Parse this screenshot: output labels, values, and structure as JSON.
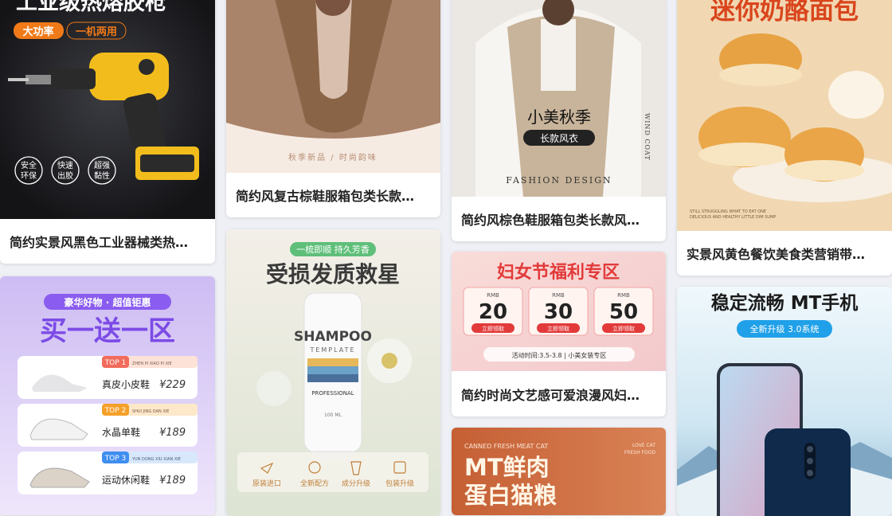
{
  "cards": [
    {
      "caption": "简约实景风黑色工业器械类热…",
      "headline": "工业级热熔胶枪",
      "badges": [
        "大功率",
        "一机两用"
      ],
      "features": [
        [
          "安全",
          "环保"
        ],
        [
          "快速",
          "出胶"
        ],
        [
          "超强",
          "黏性"
        ]
      ],
      "colors": {
        "bg": "#1d1e22",
        "accent": "#f07a18",
        "yellow": "#f2bd1c"
      }
    },
    {
      "caption": "简约风复古棕鞋服箱包类长款…",
      "subtext": "秋季新品 / 时尚韵味",
      "colors": {
        "bg": "#f3e4da",
        "coat": "#8a6446"
      }
    },
    {
      "caption": "简约风棕色鞋服箱包类长款风…",
      "title": "小美秋季",
      "pill": "长款风衣",
      "side_text": "WIND COAT",
      "footer": "FASHION DESIGN",
      "colors": {
        "bg": "#e8e4df",
        "coat": "#c8b49a"
      }
    },
    {
      "caption": "实景风黄色餐饮美食类营销带…",
      "headline": "迷你奶酪面包",
      "fine_print": [
        "STILL STRUGGLING WHAT TO EAT ONE",
        "DELICIOUS AND HEALTHY LITTLE DIM SUMP"
      ],
      "colors": {
        "bg": "#f2d9b4",
        "text": "#d9451c",
        "bun": "#e7a243"
      }
    },
    {
      "caption": "",
      "banner": "豪华好物 · 超值钜惠",
      "headline": "买一送一区",
      "items": [
        {
          "tag": "TOP 1",
          "pinyin": "ZHEN PI XIAO PI XIE",
          "name": "真皮小皮鞋",
          "price": "¥229"
        },
        {
          "tag": "TOP 2",
          "pinyin": "SHUI JING DAN XIE",
          "name": "水晶单鞋",
          "price": "¥189"
        },
        {
          "tag": "TOP 3",
          "pinyin": "YUN DONG XIU XIAN XIE",
          "name": "运动休闲鞋",
          "price": "¥189"
        }
      ],
      "colors": {
        "bg": "#d7c8f4",
        "title": "#7c4be6"
      }
    },
    {
      "caption": "",
      "pill": "一梳即顺 持久芳香",
      "headline": "受损发质救星",
      "bottle_brand": "SHAMPOO",
      "bottle_sub": "TEMPLATE",
      "bottle_script": "PROFESSIONAL",
      "bottle_volume": "100 ML",
      "features": [
        "原装进口",
        "全新配方",
        "成分升级",
        "包装升级"
      ],
      "colors": {
        "bg": "#eef3e6",
        "pill": "#5fbf7a"
      }
    },
    {
      "caption": "简约时尚文艺感可爱浪漫风妇…",
      "headline": "妇女节福利专区",
      "coupons": [
        {
          "currency": "RMB",
          "value": "20",
          "btn": "立即领取"
        },
        {
          "currency": "RMB",
          "value": "30",
          "btn": "立即领取"
        },
        {
          "currency": "RMB",
          "value": "50",
          "btn": "立即领取"
        }
      ],
      "footer": "活动时间:3.5-3.8  |  小美女装专区",
      "colors": {
        "bg": "#f8d6d6",
        "red": "#e23a3a"
      }
    },
    {
      "caption": "",
      "top_left": "CANNED FRESH MEAT CAT",
      "top_right": [
        "LOVE CAT",
        "FRESH FOOD"
      ],
      "headline_1": "MT鲜肉",
      "headline_2": "蛋白猫粮",
      "colors": {
        "bg": "#c9693d"
      }
    },
    {
      "caption": "",
      "headline": "稳定流畅 MT手机",
      "pill": "全新升级 3.0系统",
      "colors": {
        "bg": "#d8ecf6",
        "pill": "#1fa0e8"
      }
    }
  ]
}
